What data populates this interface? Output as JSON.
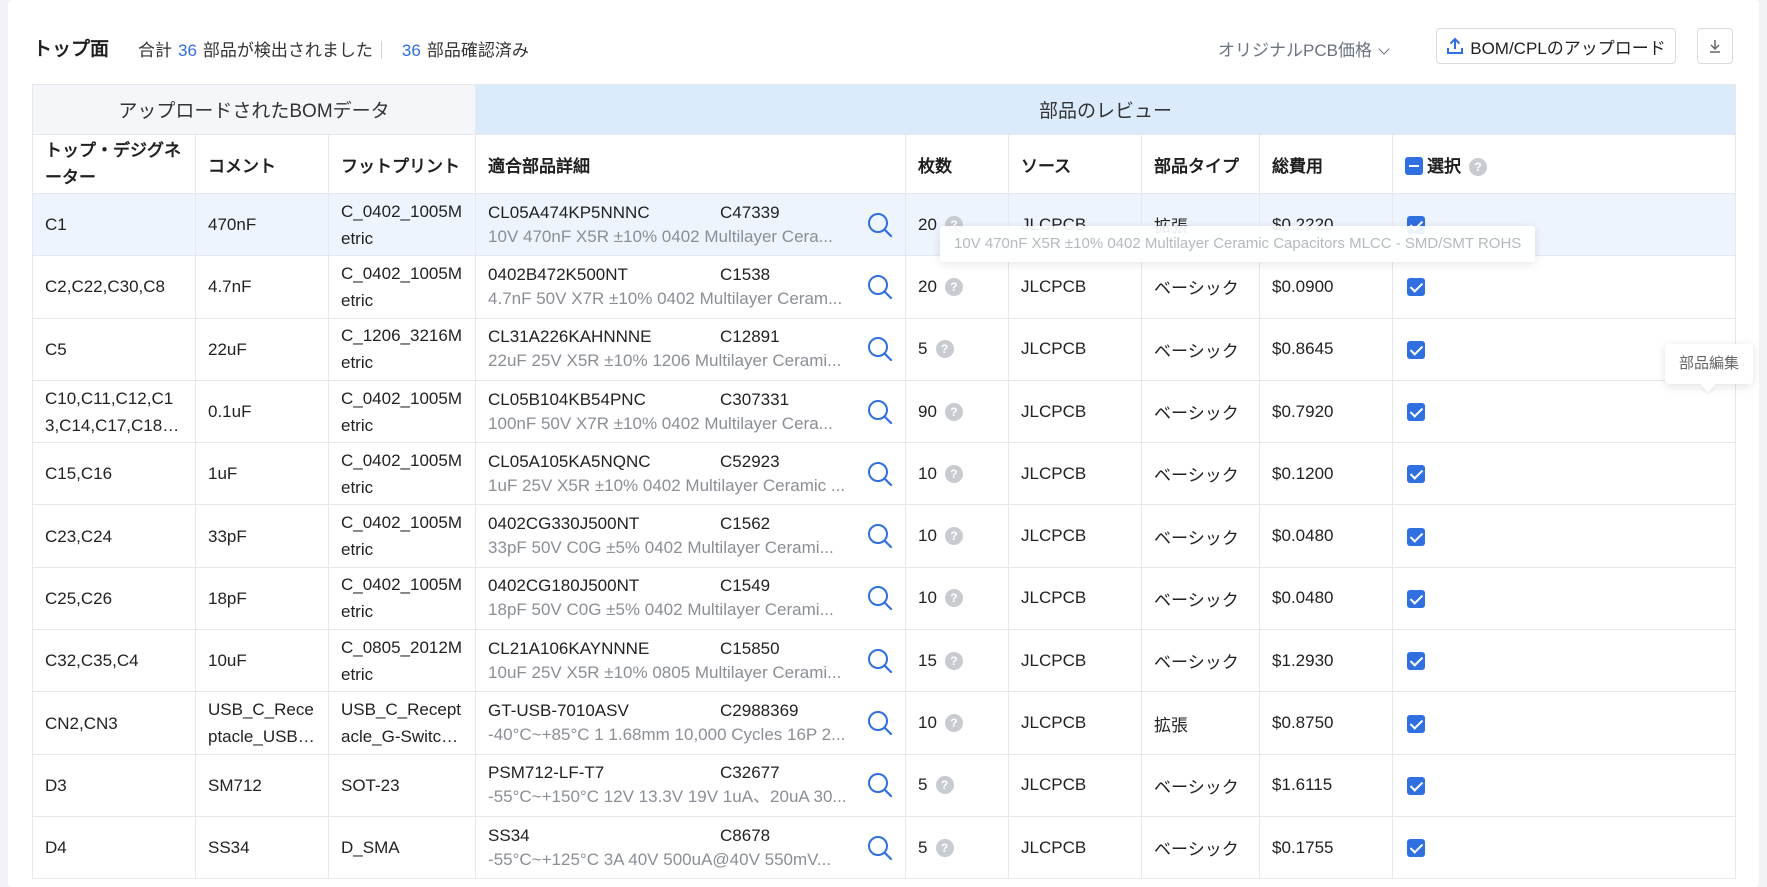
{
  "header": {
    "title": "トップ面",
    "summary_prefix": "合計",
    "detected_count": "36",
    "detected_suffix": "部品が検出されました",
    "confirmed_count": "36",
    "confirmed_suffix": "部品確認済み",
    "price_dropdown": "オリジナルPCB価格",
    "upload_button": "BOM/CPLのアップロード"
  },
  "table": {
    "group_uploaded": "アップロードされたBOMデータ",
    "group_review": "部品のレビュー",
    "columns": {
      "designator": "トップ・デジグネーター",
      "comment": "コメント",
      "footprint": "フットプリント",
      "detail": "適合部品詳細",
      "qty": "枚数",
      "source": "ソース",
      "type": "部品タイプ",
      "cost": "総費用",
      "select": "選択"
    },
    "rows": [
      {
        "designator": "C1",
        "comment": "470nF",
        "footprint": "C_0402_1005Metric",
        "mpn": "CL05A474KP5NNNC",
        "lcsc": "C47339",
        "desc": "10V 470nF X5R ±10% 0402 Multilayer Cera...",
        "qty": "20",
        "source": "JLCPCB",
        "type": "拡張",
        "cost": "$0.2220"
      },
      {
        "designator": "C2,C22,C30,C8",
        "comment": "4.7nF",
        "footprint": "C_0402_1005Metric",
        "mpn": "0402B472K500NT",
        "lcsc": "C1538",
        "desc": "4.7nF 50V X7R ±10% 0402 Multilayer Ceram...",
        "qty": "20",
        "source": "JLCPCB",
        "type": "ベーシック",
        "cost": "$0.0900"
      },
      {
        "designator": "C5",
        "comment": "22uF",
        "footprint": "C_1206_3216Metric",
        "mpn": "CL31A226KAHNNNE",
        "lcsc": "C12891",
        "desc": "22uF 25V X5R ±10% 1206 Multilayer Cerami...",
        "qty": "5",
        "source": "JLCPCB",
        "type": "ベーシック",
        "cost": "$0.8645"
      },
      {
        "designator": "C10,C11,C12,C13,C14,C17,C18,C20,C...",
        "comment": "0.1uF",
        "footprint": "C_0402_1005Metric",
        "mpn": "CL05B104KB54PNC",
        "lcsc": "C307331",
        "desc": "100nF 50V X7R ±10% 0402 Multilayer Cera...",
        "qty": "90",
        "source": "JLCPCB",
        "type": "ベーシック",
        "cost": "$0.7920"
      },
      {
        "designator": "C15,C16",
        "comment": "1uF",
        "footprint": "C_0402_1005Metric",
        "mpn": "CL05A105KA5NQNC",
        "lcsc": "C52923",
        "desc": "1uF 25V X5R ±10% 0402 Multilayer Ceramic ...",
        "qty": "10",
        "source": "JLCPCB",
        "type": "ベーシック",
        "cost": "$0.1200"
      },
      {
        "designator": "C23,C24",
        "comment": "33pF",
        "footprint": "C_0402_1005Metric",
        "mpn": "0402CG330J500NT",
        "lcsc": "C1562",
        "desc": "33pF 50V C0G ±5% 0402 Multilayer Cerami...",
        "qty": "10",
        "source": "JLCPCB",
        "type": "ベーシック",
        "cost": "$0.0480"
      },
      {
        "designator": "C25,C26",
        "comment": "18pF",
        "footprint": "C_0402_1005Metric",
        "mpn": "0402CG180J500NT",
        "lcsc": "C1549",
        "desc": "18pF 50V C0G ±5% 0402 Multilayer Cerami...",
        "qty": "10",
        "source": "JLCPCB",
        "type": "ベーシック",
        "cost": "$0.0480"
      },
      {
        "designator": "C32,C35,C4",
        "comment": "10uF",
        "footprint": "C_0805_2012Metric",
        "mpn": "CL21A106KAYNNNE",
        "lcsc": "C15850",
        "desc": "10uF 25V X5R ±10% 0805 Multilayer Cerami...",
        "qty": "15",
        "source": "JLCPCB",
        "type": "ベーシック",
        "cost": "$1.2930"
      },
      {
        "designator": "CN2,CN3",
        "comment": "USB_C_Receptacle_USB2.0_...",
        "footprint": "USB_C_Receptacle_G-Switch_...",
        "mpn": "GT-USB-7010ASV",
        "lcsc": "C2988369",
        "desc": "-40°C~+85°C 1 1.68mm 10,000 Cycles 16P 2...",
        "qty": "10",
        "source": "JLCPCB",
        "type": "拡張",
        "cost": "$0.8750"
      },
      {
        "designator": "D3",
        "comment": "SM712",
        "footprint": "SOT-23",
        "mpn": "PSM712-LF-T7",
        "lcsc": "C32677",
        "desc": "-55°C~+150°C 12V 13.3V 19V 1uA、20uA 30...",
        "qty": "5",
        "source": "JLCPCB",
        "type": "ベーシック",
        "cost": "$1.6115"
      },
      {
        "designator": "D4",
        "comment": "SS34",
        "footprint": "D_SMA",
        "mpn": "SS34",
        "lcsc": "C8678",
        "desc": "-55°C~+125°C 3A 40V 500uA@40V 550mV...",
        "qty": "5",
        "source": "JLCPCB",
        "type": "ベーシック",
        "cost": "$0.1755"
      }
    ]
  },
  "tooltip": "10V 470nF X5R ±10% 0402 Multilayer Ceramic Capacitors MLCC - SMD/SMT ROHS",
  "edit_tooltip": "部品編集",
  "help_glyph": "?",
  "colors": {
    "accent": "#2f6fe0",
    "review_header": "#dcebfb",
    "row_highlight": "#eef4fd"
  }
}
